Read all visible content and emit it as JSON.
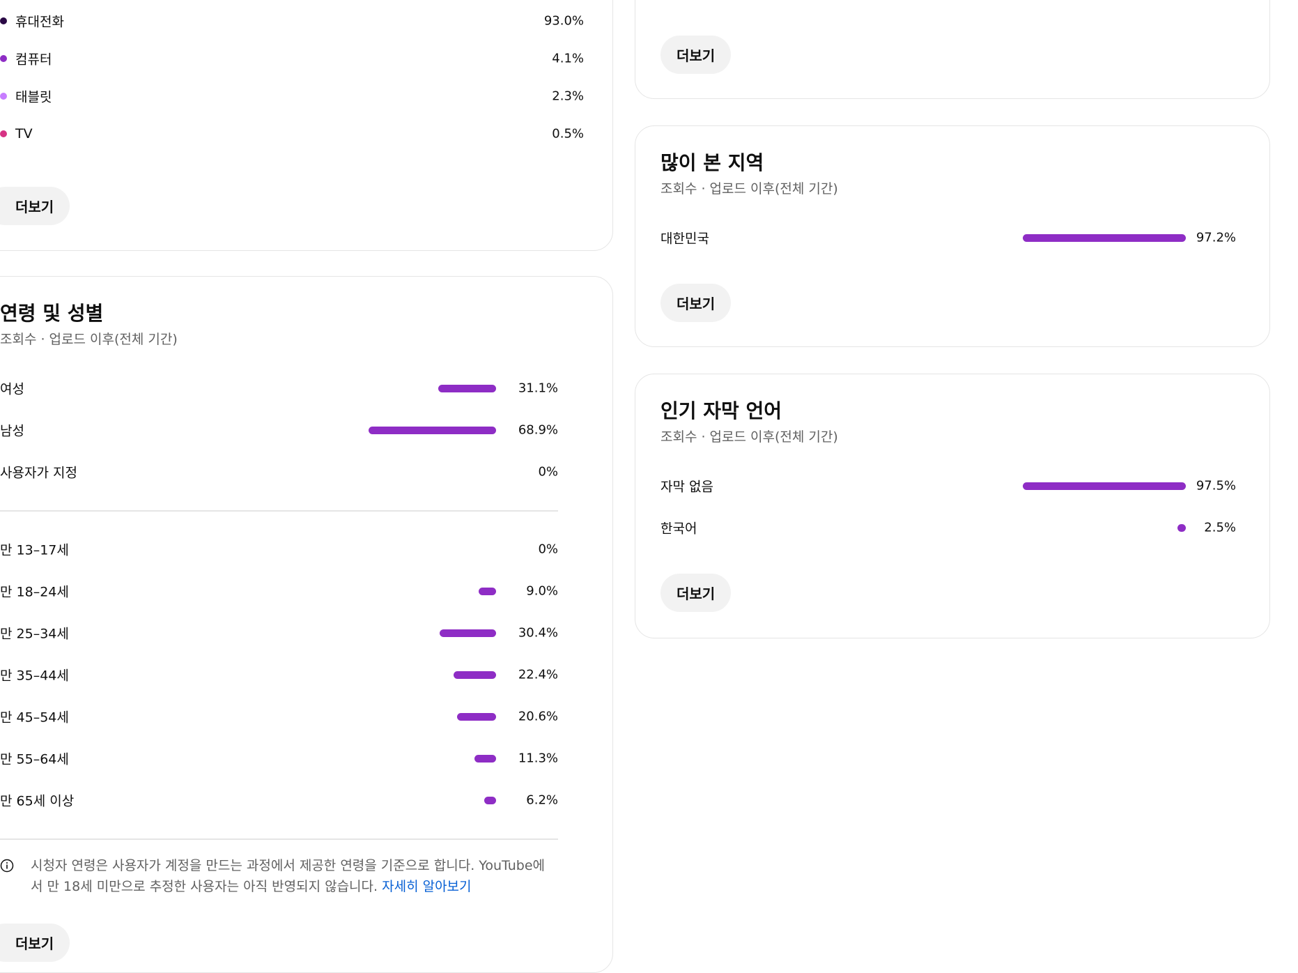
{
  "colors": {
    "accent": "#8e2dc5",
    "device_colors": [
      "#2a0845",
      "#8e2dc5",
      "#c77dff",
      "#d63384"
    ]
  },
  "devices": {
    "rows": [
      {
        "label": "휴대전화",
        "value": "93.0%"
      },
      {
        "label": "컴퓨터",
        "value": "4.1%"
      },
      {
        "label": "태블릿",
        "value": "2.3%"
      },
      {
        "label": "TV",
        "value": "0.5%"
      }
    ],
    "more_label": "더보기"
  },
  "age_gender": {
    "title": "연령 및 성별",
    "subtitle": "조회수 · 업로드 이후(전체 기간)",
    "gender_rows": [
      {
        "label": "여성",
        "value": "31.1%",
        "fraction": 0.311
      },
      {
        "label": "남성",
        "value": "68.9%",
        "fraction": 0.689
      },
      {
        "label": "사용자가 지정",
        "value": "0%",
        "fraction": 0
      }
    ],
    "age_rows": [
      {
        "label": "만 13–17세",
        "value": "0%",
        "fraction": 0
      },
      {
        "label": "만 18–24세",
        "value": "9.0%",
        "fraction": 0.09
      },
      {
        "label": "만 25–34세",
        "value": "30.4%",
        "fraction": 0.304
      },
      {
        "label": "만 35–44세",
        "value": "22.4%",
        "fraction": 0.224
      },
      {
        "label": "만 45–54세",
        "value": "20.6%",
        "fraction": 0.206
      },
      {
        "label": "만 55–64세",
        "value": "11.3%",
        "fraction": 0.113
      },
      {
        "label": "만 65세 이상",
        "value": "6.2%",
        "fraction": 0.062
      }
    ],
    "note_line1": "시청자 연령은 사용자가 계정을 만드는 과정에서 제공한 연령을 기준으로 합니다. YouTube에",
    "note_line2": "서 만 18세 미만으로 추정한 사용자는 아직 반영되지 않습니다.",
    "note_link": "자세히 알아보기",
    "more_label": "더보기"
  },
  "top_card": {
    "more_label": "더보기"
  },
  "regions": {
    "title": "많이 본 지역",
    "subtitle": "조회수 · 업로드 이후(전체 기간)",
    "rows": [
      {
        "label": "대한민국",
        "value": "97.2%",
        "fraction": 0.972
      }
    ],
    "more_label": "더보기"
  },
  "subtitles": {
    "title": "인기 자막 언어",
    "subtitle": "조회수 · 업로드 이후(전체 기간)",
    "rows": [
      {
        "label": "자막 없음",
        "value": "97.5%",
        "fraction": 0.975
      },
      {
        "label": "한국어",
        "value": "2.5%",
        "fraction": 0.025
      }
    ],
    "more_label": "더보기"
  }
}
